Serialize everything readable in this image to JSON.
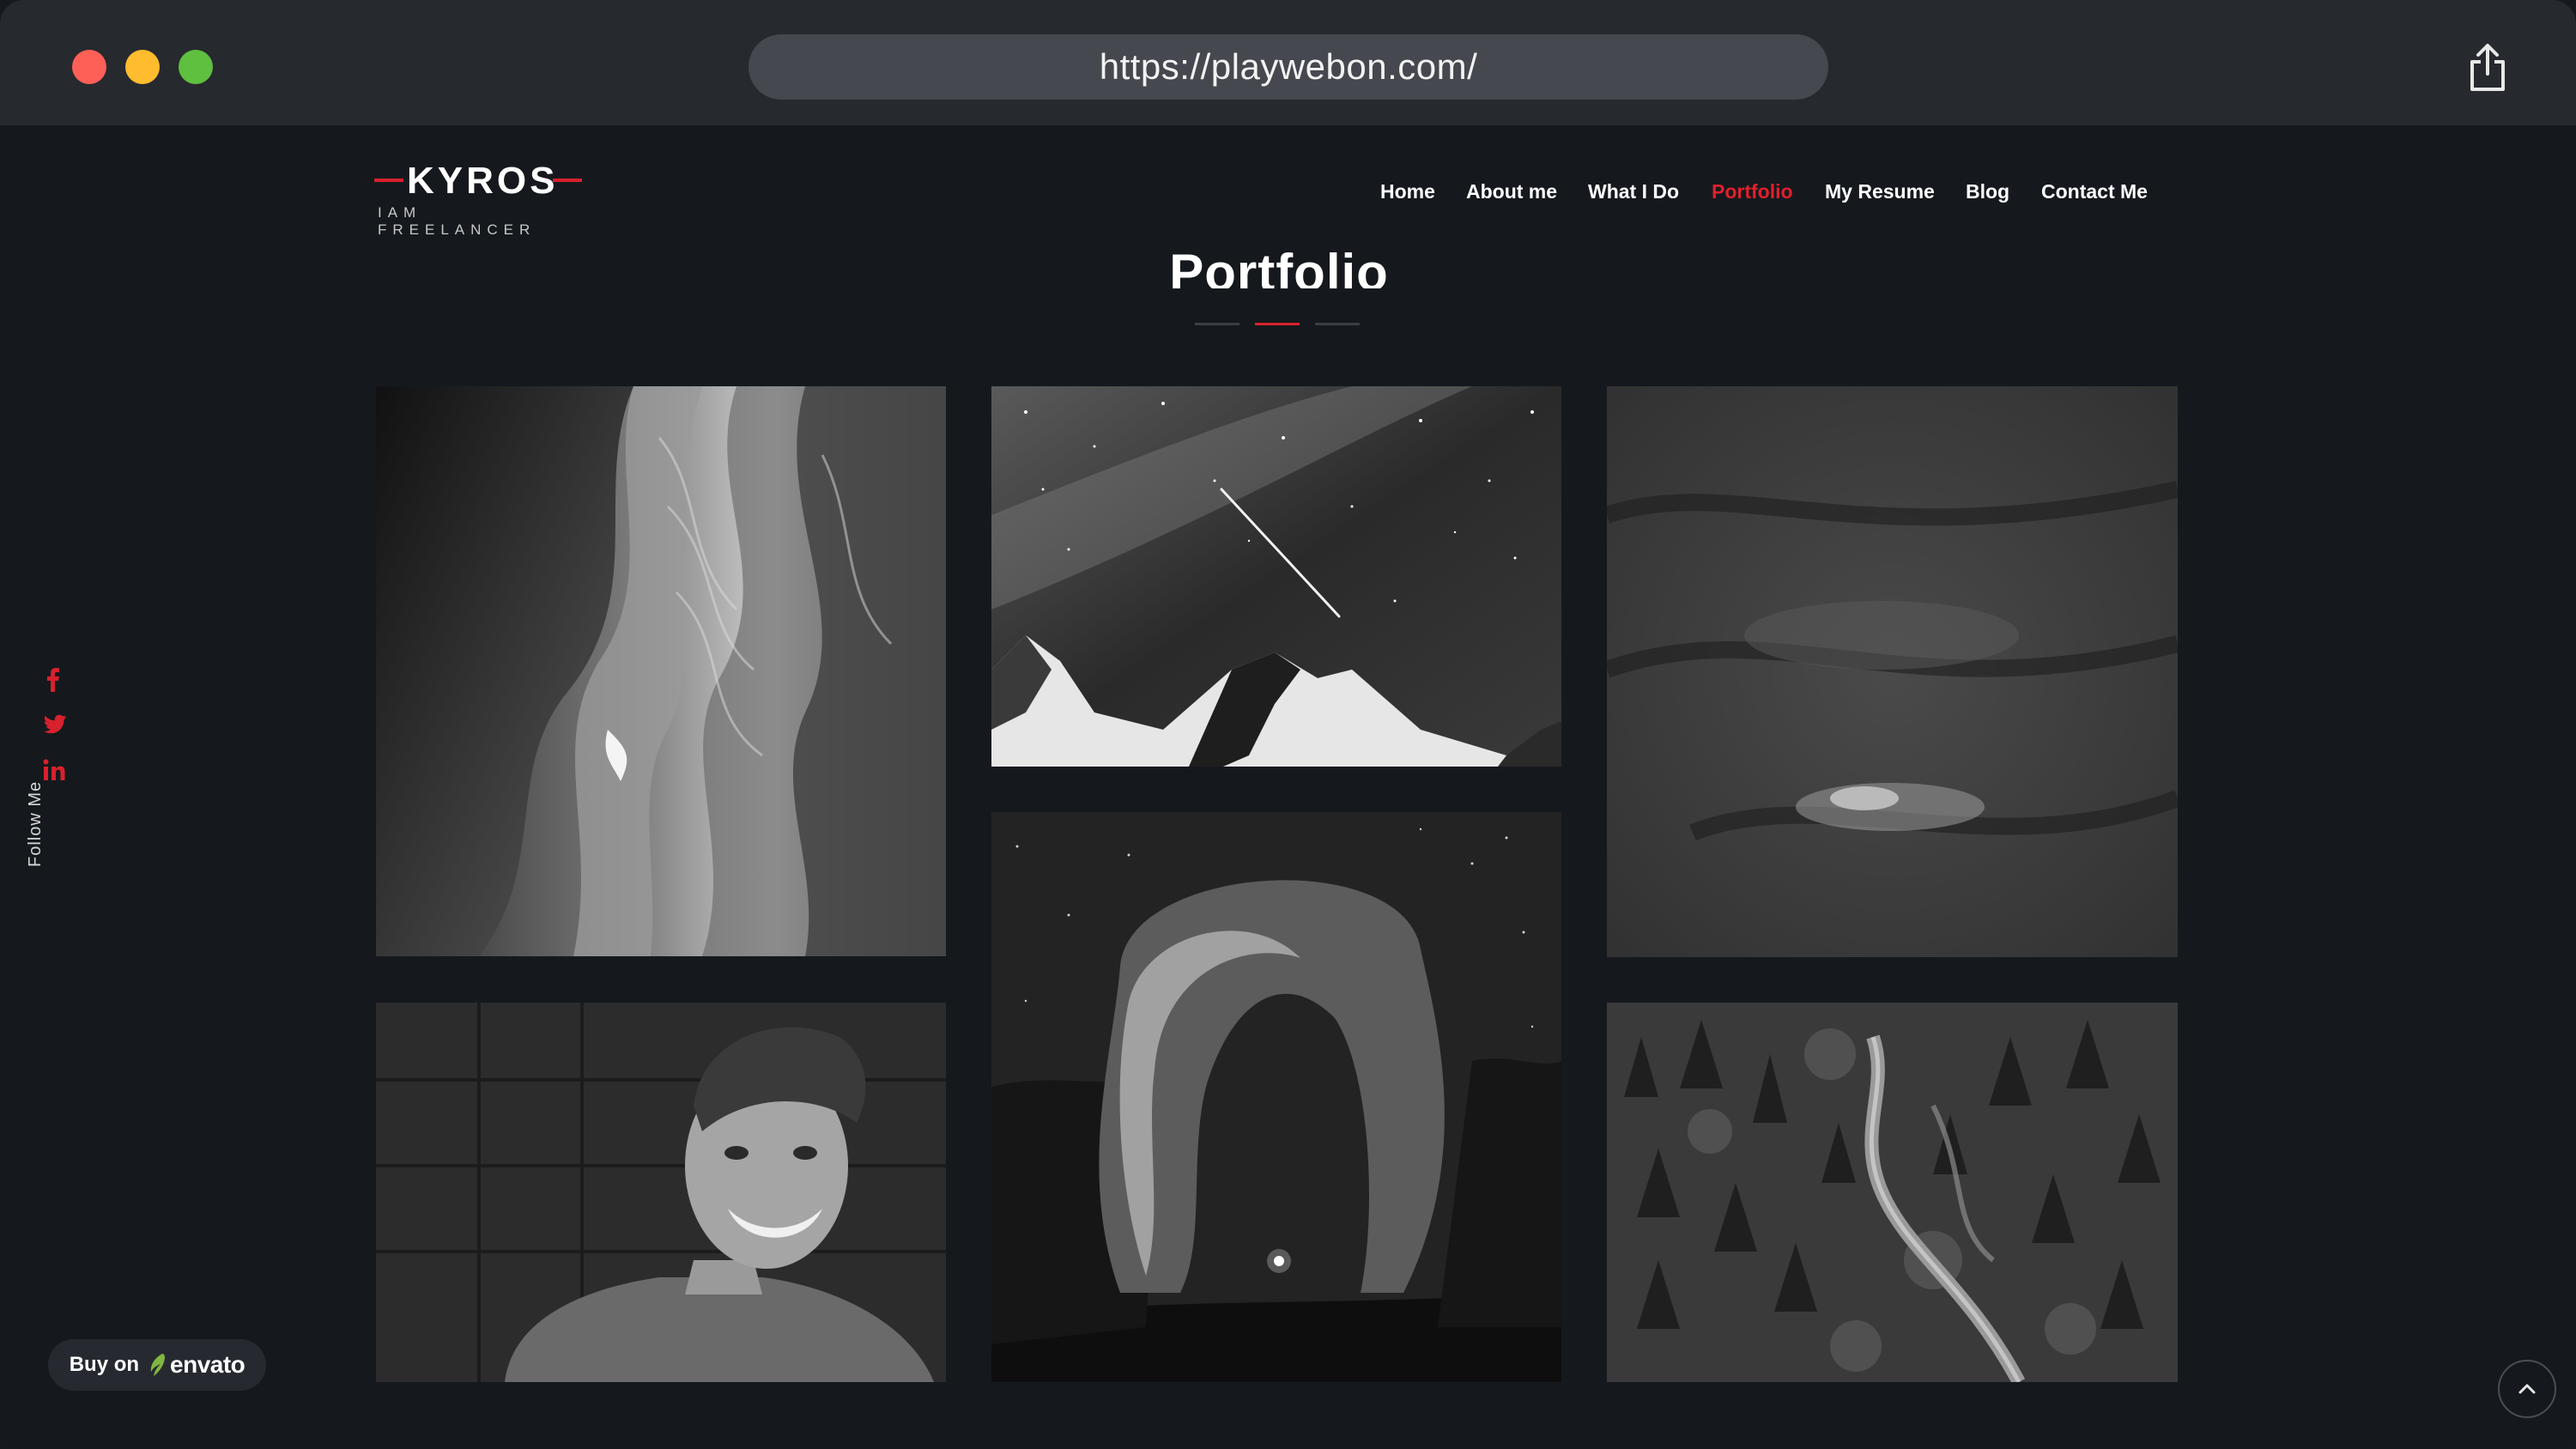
{
  "browser": {
    "url": "https://playwebon.com/"
  },
  "brand": {
    "name": "KYROS",
    "tagline": "IAM FREELANCER"
  },
  "nav": {
    "items": [
      {
        "label": "Home"
      },
      {
        "label": "About me"
      },
      {
        "label": "What I Do"
      },
      {
        "label": "Portfolio",
        "active": true
      },
      {
        "label": "My Resume"
      },
      {
        "label": "Blog"
      },
      {
        "label": "Contact Me"
      }
    ]
  },
  "section": {
    "title": "Portfolio"
  },
  "social": {
    "follow_label": "Follow Me",
    "icons": [
      "facebook-icon",
      "twitter-icon",
      "linkedin-icon"
    ]
  },
  "portfolio": {
    "items": [
      {
        "subject": "slot-canyon"
      },
      {
        "subject": "night-sky-mountain"
      },
      {
        "subject": "dark-clouds"
      },
      {
        "subject": "smiling-man-portrait"
      },
      {
        "subject": "rock-arch-night"
      },
      {
        "subject": "forest-road-aerial"
      }
    ]
  },
  "buy_badge": {
    "prefix": "Buy on",
    "brand": "envato"
  },
  "colors": {
    "accent": "#d7212d",
    "background": "#15191d",
    "chrome": "#26292e"
  }
}
